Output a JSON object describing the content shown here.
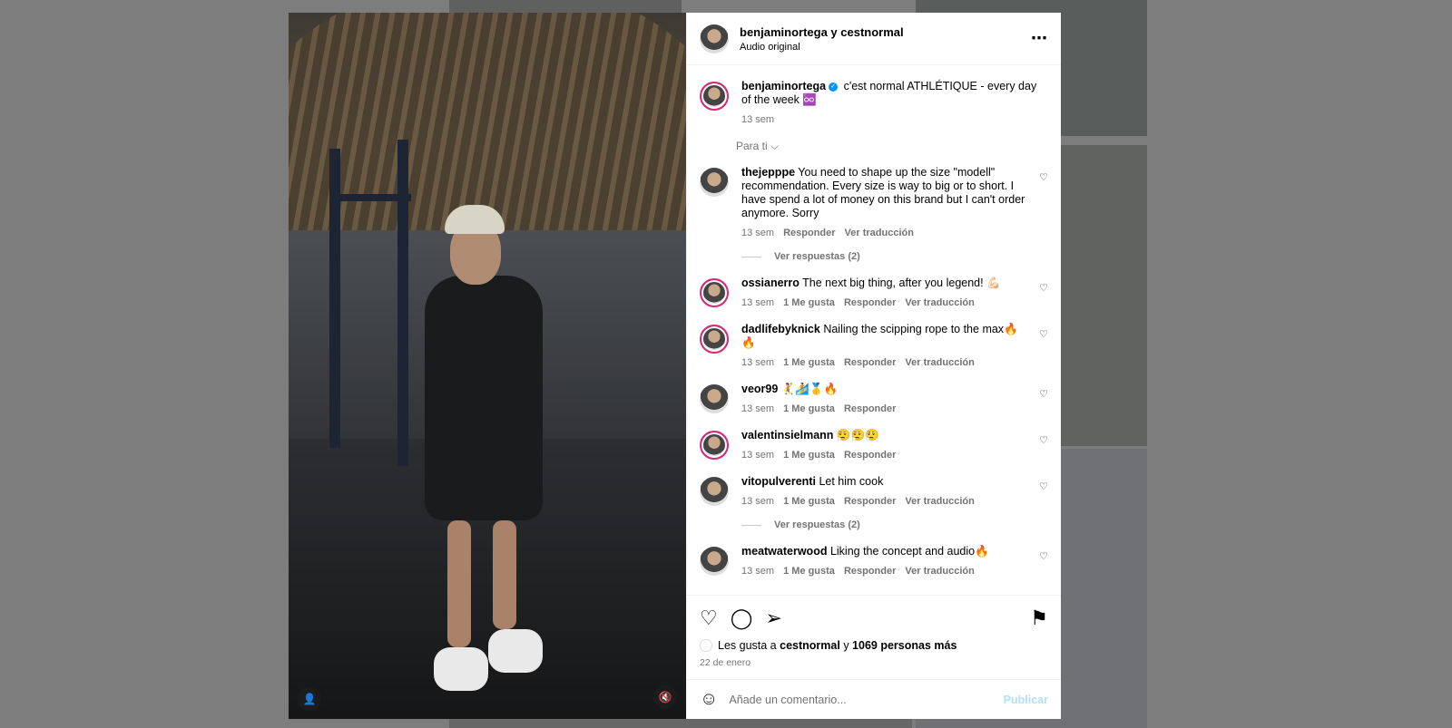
{
  "header": {
    "title": "benjaminortega y cestnormal",
    "subtitle": "Audio original",
    "more_icon": "⋯"
  },
  "caption": {
    "username": "benjaminortega",
    "text": "c'est normal ATHLÉTIQUE - every day of the week ♾️",
    "time": "13 sem"
  },
  "sort_label": "Para ti ⌵",
  "comments": [
    {
      "username": "thejepppe",
      "text": "You need to shape up the size \"modell\" recommendation. Every size is way to big or to short. I have spend a lot of money on this brand but I can't order anymore. Sorry",
      "time": "13 sem",
      "likes": "",
      "reply": "Responder",
      "translate": "Ver traducción",
      "replies": "Ver respuestas (2)"
    },
    {
      "username": "ossianerro",
      "text": "The next big thing, after you legend! 💪🏻",
      "time": "13 sem",
      "likes": "1 Me gusta",
      "reply": "Responder",
      "translate": "Ver traducción"
    },
    {
      "username": "dadlifebyknick",
      "text": "Nailing the scipping rope to the max🔥🔥",
      "time": "13 sem",
      "likes": "1 Me gusta",
      "reply": "Responder",
      "translate": "Ver traducción"
    },
    {
      "username": "veor99",
      "text": "🤾🏄🥇🔥",
      "time": "13 sem",
      "likes": "1 Me gusta",
      "reply": "Responder",
      "translate": ""
    },
    {
      "username": "valentinsielmann",
      "text": "😮‍💨😮‍💨😮‍💨",
      "time": "13 sem",
      "likes": "1 Me gusta",
      "reply": "Responder",
      "translate": ""
    },
    {
      "username": "vitopulverenti",
      "text": "Let him cook",
      "time": "13 sem",
      "likes": "1 Me gusta",
      "reply": "Responder",
      "translate": "Ver traducción",
      "replies": "Ver respuestas (2)"
    },
    {
      "username": "meatwaterwood",
      "text": "Liking the concept and audio🔥",
      "time": "13 sem",
      "likes": "1 Me gusta",
      "reply": "Responder",
      "translate": "Ver traducción"
    }
  ],
  "actions": {
    "like_icon": "♡",
    "comment_icon": "◯",
    "share_icon": "➢",
    "save_icon": "⚑",
    "likes_prefix": "Les gusta a",
    "likes_user": "cestnormal",
    "likes_and": "y",
    "likes_others": "1069 personas más",
    "date": "22 de enero"
  },
  "composer": {
    "emoji_icon": "☺",
    "placeholder": "Añade un comentario...",
    "publish": "Publicar"
  },
  "media": {
    "user_icon": "👤",
    "mute_icon": "🔇"
  }
}
